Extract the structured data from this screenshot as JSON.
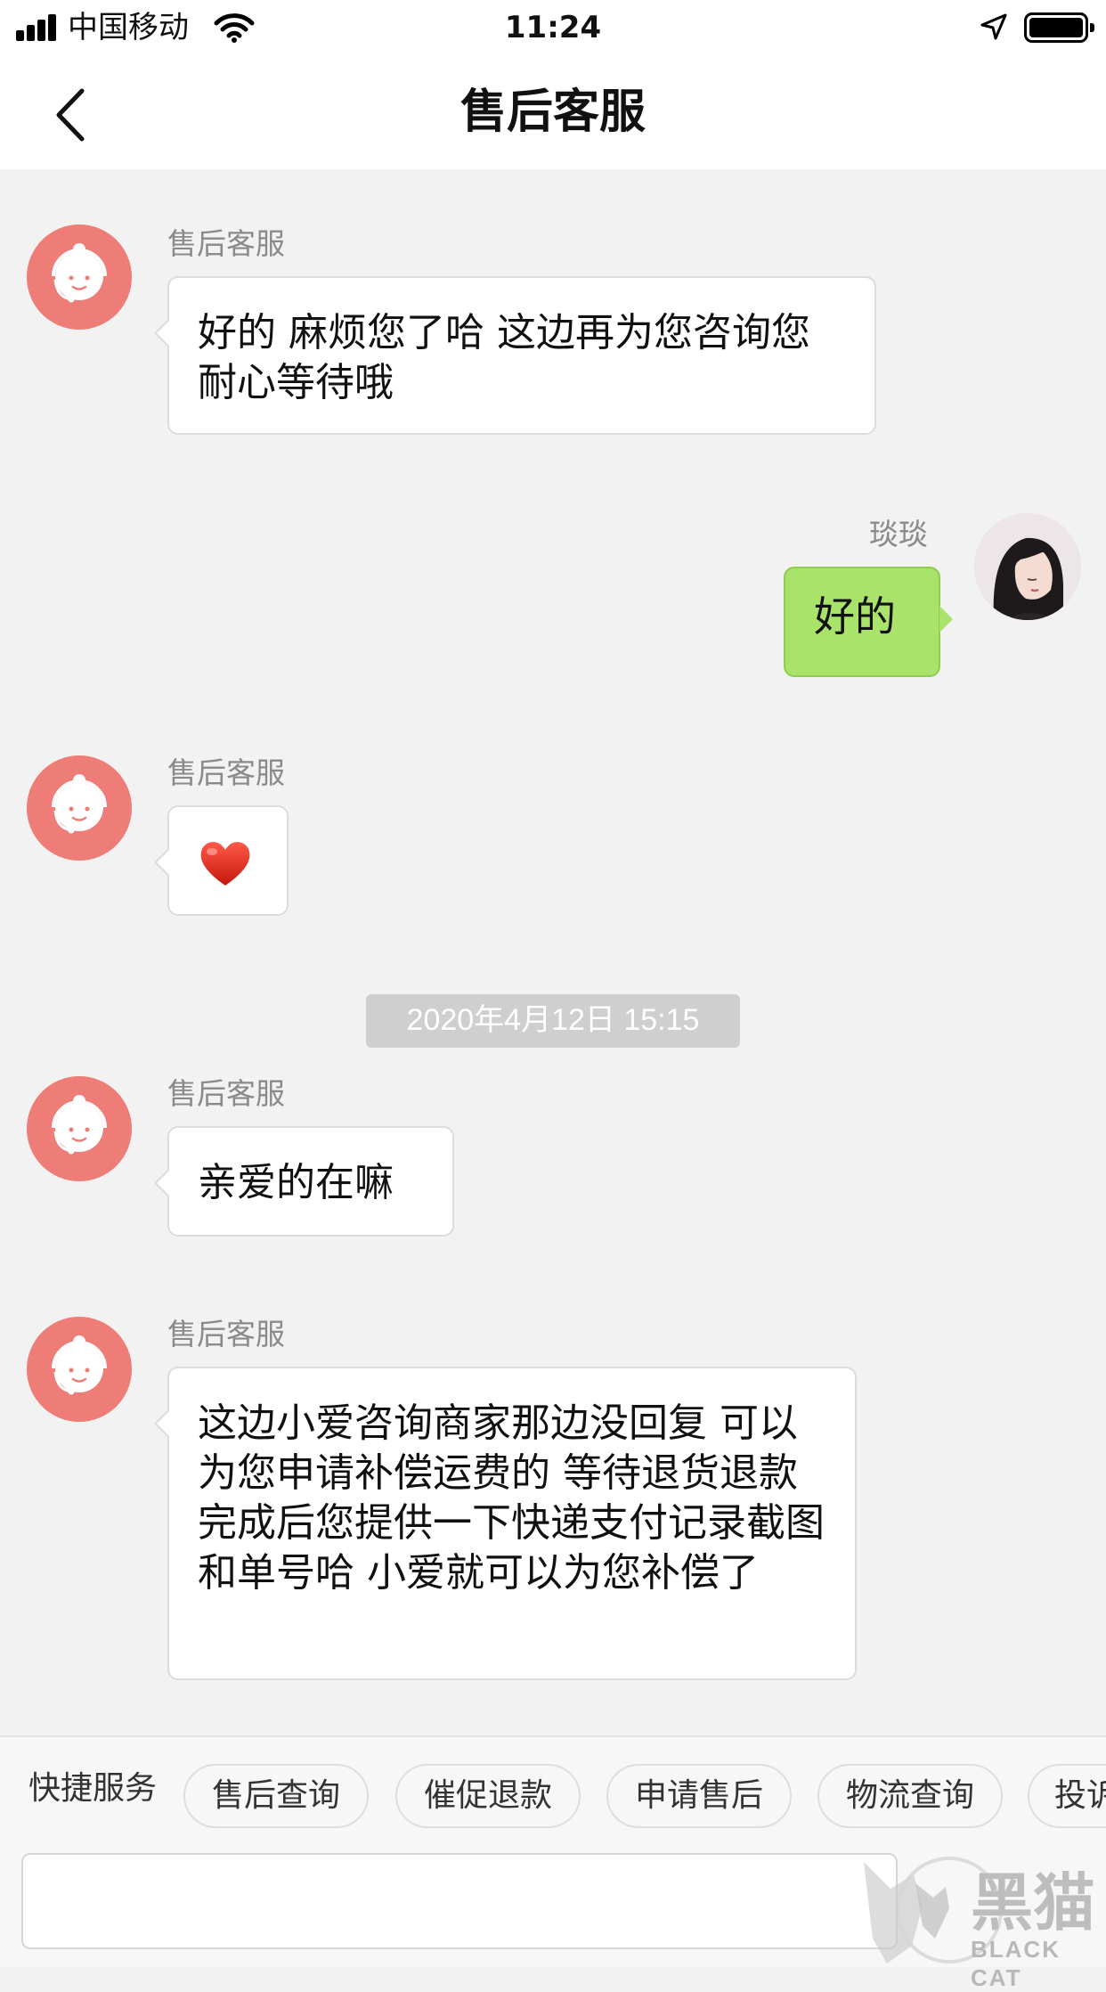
{
  "status_bar": {
    "carrier": "中国移动",
    "time": "11:24"
  },
  "nav": {
    "title": "售后客服"
  },
  "messages": [
    {
      "sender": "售后客服",
      "text": "好的 麻烦您了哈 这边再为您咨询您耐心等待哦"
    },
    {
      "sender": "琰琰",
      "text": "好的"
    },
    {
      "sender": "售后客服",
      "text": "❤️",
      "icon": "heart-emoji-icon"
    },
    {
      "sender": "售后客服",
      "text": "亲爱的在嘛"
    },
    {
      "sender": "售后客服",
      "text": "这边小爱咨询商家那边没回复 可以为您申请补偿运费的 等待退货退款完成后您提供一下快递支付记录截图和单号哈 小爱就可以为您补偿了"
    }
  ],
  "timestamp": "2020年4月12日 15:15",
  "quick_services": {
    "label": "快捷服务",
    "chips": [
      "售后查询",
      "催促退款",
      "申请售后",
      "物流查询",
      "投诉"
    ]
  },
  "watermark": {
    "text": "黑猫",
    "subtext": "BLACK CAT"
  },
  "colors": {
    "agent_avatar": "#ee7c77",
    "user_bubble": "#a9e36b",
    "background": "#f2f2f2"
  }
}
